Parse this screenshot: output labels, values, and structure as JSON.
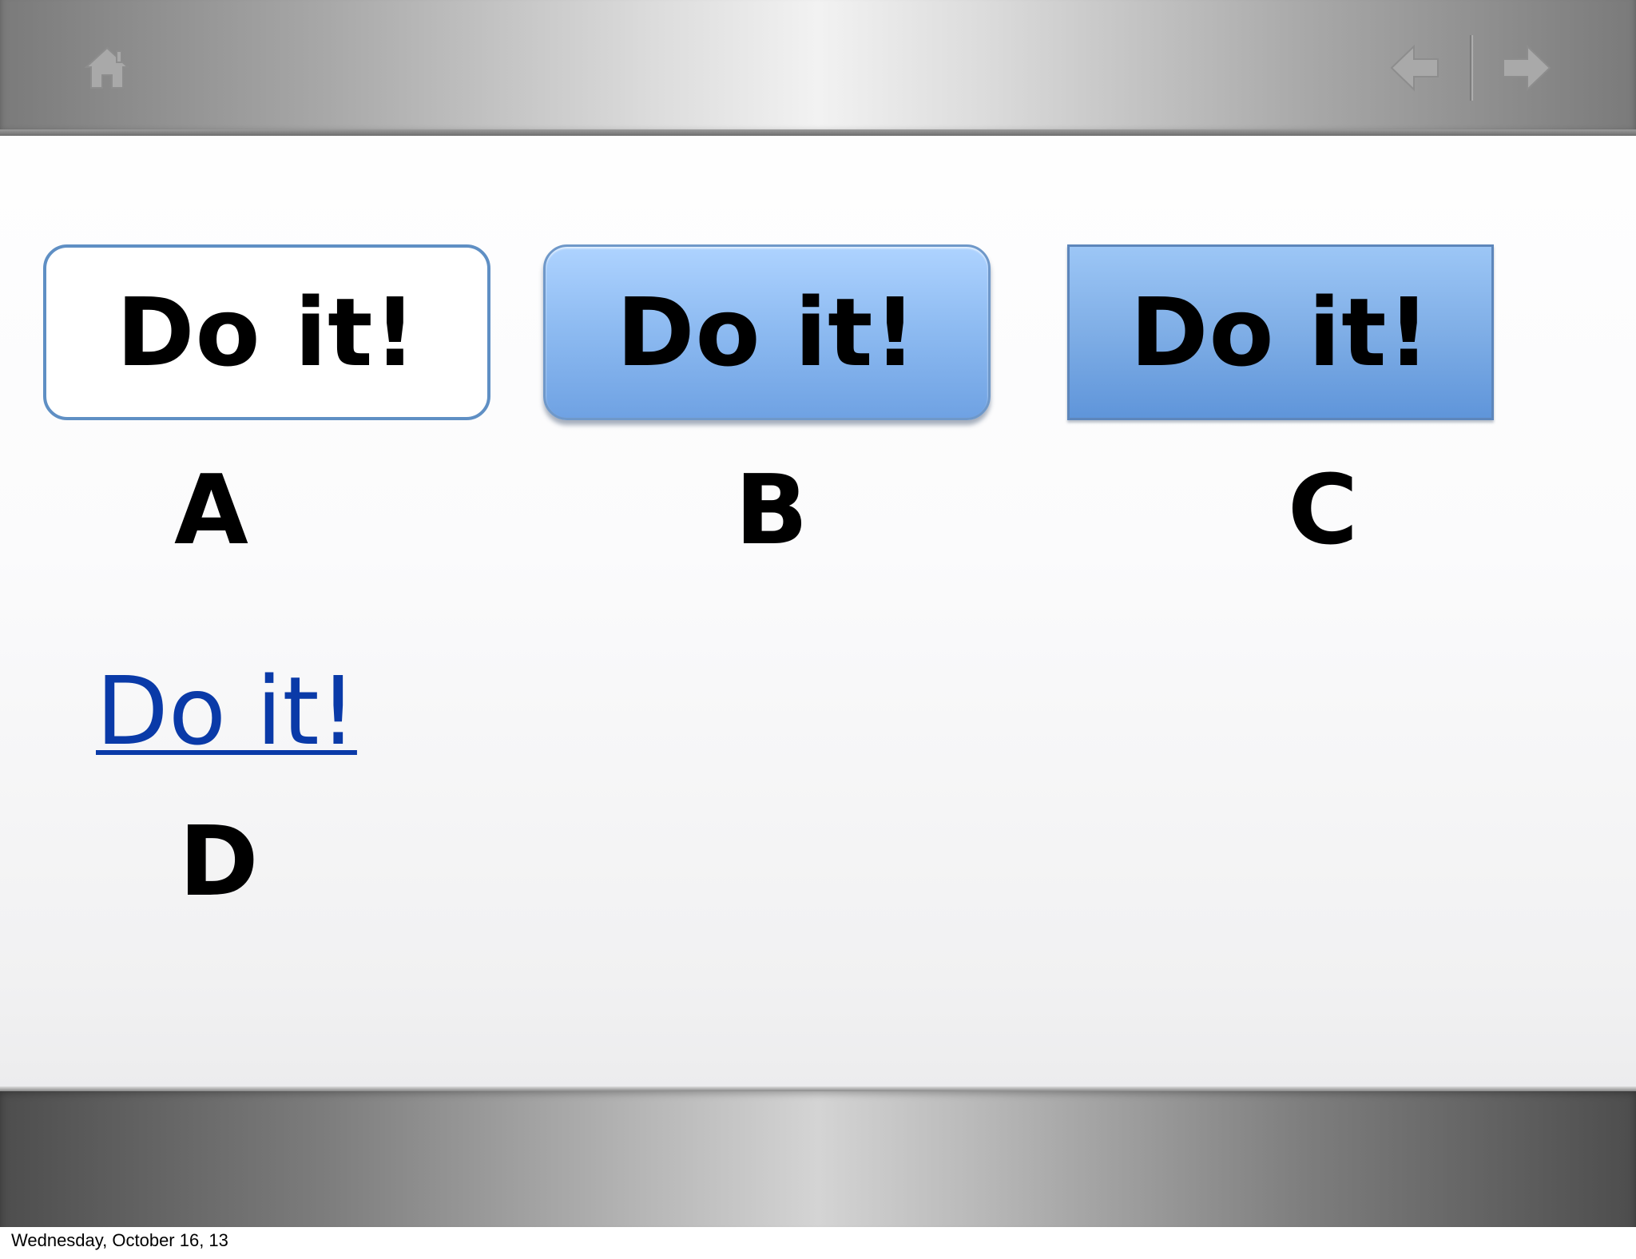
{
  "slide": {
    "buttons": [
      {
        "id": "a",
        "text": "Do it!",
        "label": "A"
      },
      {
        "id": "b",
        "text": "Do it!",
        "label": "B"
      },
      {
        "id": "c",
        "text": "Do it!",
        "label": "C"
      }
    ],
    "link": {
      "text": "Do it!",
      "label": "D"
    }
  },
  "toolbar": {
    "icons": {
      "home": "home-icon",
      "back": "back-arrow-icon",
      "forward": "forward-arrow-icon"
    }
  },
  "footer": {
    "date": "Wednesday, October 16, 13"
  },
  "colors": {
    "link": "#0a3aa8",
    "button_border": "#5f8fc4",
    "button_fill_top": "#aed3ff",
    "button_fill_bottom": "#6fa2e3"
  }
}
